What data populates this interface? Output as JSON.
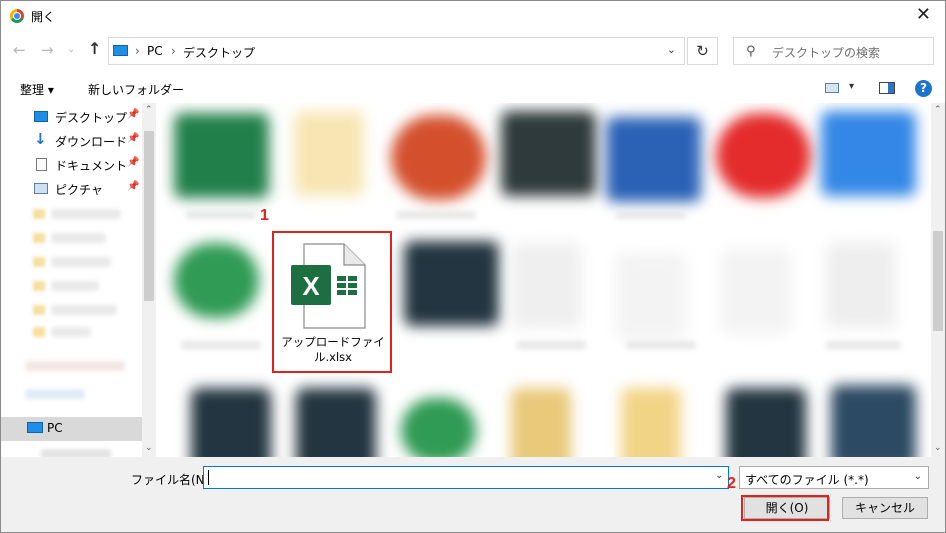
{
  "window": {
    "title": "開く",
    "close_glyph": "✕"
  },
  "address": {
    "breadcrumbs": [
      "PC",
      "デスクトップ"
    ],
    "separator": "›",
    "search_placeholder": "デスクトップの検索"
  },
  "toolbar": {
    "organize_label": "整理",
    "new_folder_label": "新しいフォルダー",
    "help_label": "?"
  },
  "nav": {
    "items": [
      {
        "label": "デスクトップ",
        "icon": "desktop-icon"
      },
      {
        "label": "ダウンロード",
        "icon": "download-icon"
      },
      {
        "label": "ドキュメント",
        "icon": "document-icon"
      },
      {
        "label": "ピクチャ",
        "icon": "picture-icon"
      }
    ],
    "pc_label": "PC"
  },
  "file": {
    "label": "アップロードファイル.xlsx",
    "icon": "excel-file-icon",
    "badge_color": "#1d6f42"
  },
  "annotations": {
    "step1": "1",
    "step2": "2",
    "mark_color": "#e0221b"
  },
  "footer": {
    "filename_label": "ファイル名(N):",
    "filename_value": "",
    "filetype_value": "すべてのファイル (*.*)",
    "open_label": "開く(O)",
    "cancel_label": "キャンセル"
  }
}
